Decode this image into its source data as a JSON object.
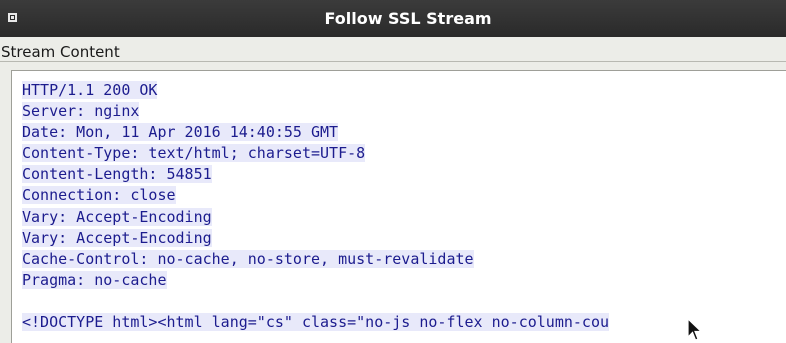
{
  "window": {
    "title": "Follow SSL Stream"
  },
  "frame": {
    "label": "Stream Content"
  },
  "stream": {
    "lines": [
      "HTTP/1.1 200 OK",
      "Server: nginx",
      "Date: Mon, 11 Apr 2016 14:40:55 GMT",
      "Content-Type: text/html; charset=UTF-8",
      "Content-Length: 54851",
      "Connection: close",
      "Vary: Accept-Encoding",
      "Vary: Accept-Encoding",
      "Cache-Control: no-cache, no-store, must-revalidate",
      "Pragma: no-cache",
      "",
      "<!DOCTYPE html><html lang=\"cs\" class=\"no-js no-flex no-column-cou"
    ]
  },
  "colors": {
    "titlebar": "#2a2a2a",
    "stream_text": "#1c1c8e",
    "stream_highlight": "#e8e9fa"
  }
}
